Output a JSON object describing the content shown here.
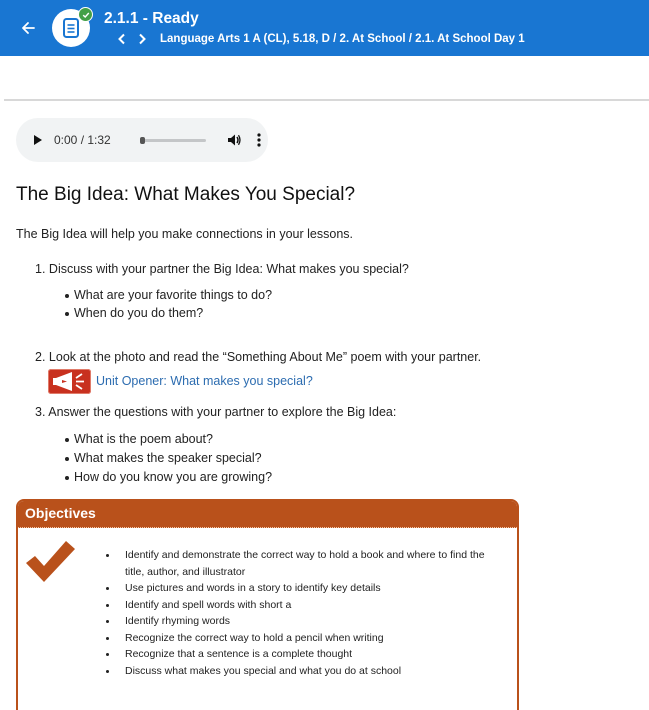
{
  "header": {
    "title": "2.1.1 - Ready",
    "breadcrumb": "Language Arts 1 A (CL), 5.18, D / 2. At School / 2.1. At School Day 1",
    "back_icon": "arrow-left-icon",
    "prev_icon": "chevron-left-icon",
    "next_icon": "chevron-right-icon",
    "doc_icon": "document-icon",
    "status_icon": "check-circle-icon",
    "bg_color": "#1976d2",
    "status_color": "#43a047"
  },
  "audio": {
    "time": "0:00 / 1:32",
    "progress": 0
  },
  "content": {
    "title": "The Big Idea: What Makes You Special?",
    "intro": "The Big Idea will help you make connections in your lessons.",
    "steps": [
      {
        "number": "1.",
        "text": "Discuss with your partner the Big Idea: What makes you special?",
        "bullets": [
          "What are your favorite things to do?",
          "When do you do them?"
        ]
      },
      {
        "number": "2.",
        "text": "Look at the photo and read the “Something About Me” poem with your partner.",
        "link": "Unit Opener: What makes you special?"
      },
      {
        "number": "3.",
        "text": "Answer the questions with your partner to explore the Big Idea:",
        "bullets": [
          "What is the poem about?",
          "What makes the speaker special?",
          "How do you know you are growing?"
        ]
      }
    ]
  },
  "objectives": {
    "heading": "Objectives",
    "accent_color": "#b9511b",
    "items": [
      "Identify and demonstrate the correct way to hold a book and where to find the title, author, and illustrator",
      "Use pictures and words in a story to identify key details",
      "Identify and spell words with short a",
      "Identify rhyming words",
      "Recognize the correct way to hold a pencil when writing",
      "Recognize that a sentence is a complete thought",
      "Discuss what makes you special and what you do at school"
    ]
  }
}
